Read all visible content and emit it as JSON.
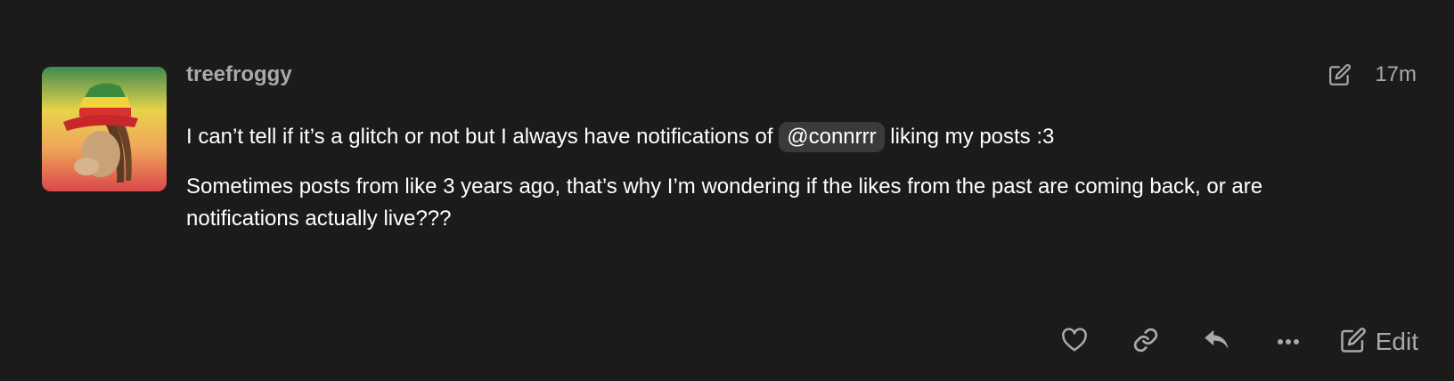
{
  "post": {
    "username": "treefroggy",
    "time": "17m",
    "body": {
      "p1_before": "I can’t tell if it’s a glitch or not but I always have notifications of ",
      "mention": "@connrrr",
      "p1_after": " liking my posts :3",
      "p2": "Sometimes posts from like 3 years ago, that’s why I’m wondering if the likes from the past are coming back, or are notifications actually live???"
    }
  },
  "actions": {
    "icons": [
      "heart-icon",
      "link-icon",
      "reply-icon",
      "more-icon",
      "edit-icon"
    ],
    "edit_label": "Edit"
  },
  "colors": {
    "background": "#1b1b1b",
    "muted_text": "#a9a9a9",
    "text": "#ffffff",
    "mention_bg": "#3a3a3a"
  }
}
